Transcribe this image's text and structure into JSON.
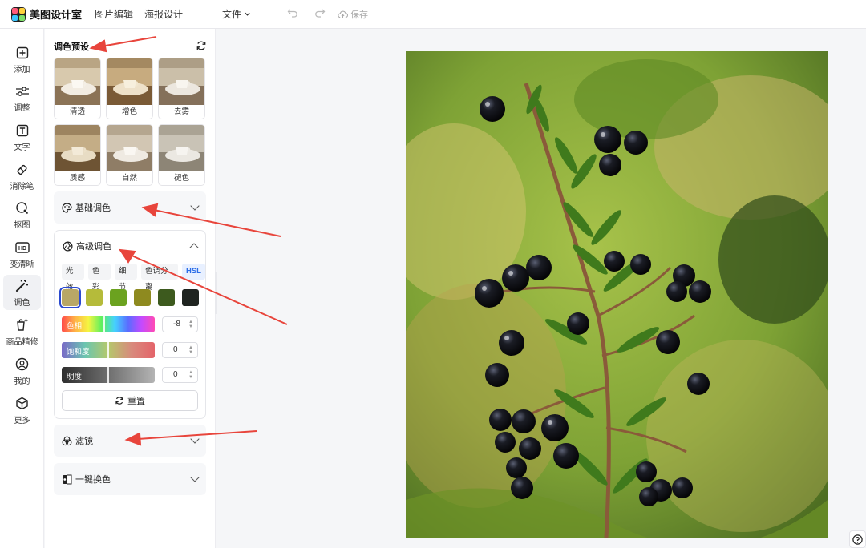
{
  "app": {
    "name": "美图设计室"
  },
  "header": {
    "nav": [
      "图片编辑",
      "海报设计"
    ],
    "file_menu": "文件",
    "save_label": "保存"
  },
  "sidebar": {
    "items": [
      {
        "label": "添加",
        "icon": "plus-square-icon"
      },
      {
        "label": "调整",
        "icon": "sliders-icon"
      },
      {
        "label": "文字",
        "icon": "text-icon"
      },
      {
        "label": "消除笔",
        "icon": "eraser-icon"
      },
      {
        "label": "抠图",
        "icon": "cutout-icon"
      },
      {
        "label": "变清晰",
        "icon": "hd-icon"
      },
      {
        "label": "调色",
        "icon": "magic-wand-icon",
        "active": true
      },
      {
        "label": "商品精修",
        "icon": "product-retouch-icon"
      },
      {
        "label": "我的",
        "icon": "user-icon"
      },
      {
        "label": "更多",
        "icon": "cube-icon"
      }
    ]
  },
  "panel": {
    "presets_title": "调色预设",
    "presets": [
      "清透",
      "增色",
      "去雾",
      "质感",
      "自然",
      "褪色"
    ],
    "basic_color": "基础调色",
    "advanced": {
      "title": "高级调色",
      "tabs": [
        "光效",
        "色彩",
        "细节",
        "色调分离",
        "HSL"
      ],
      "active_tab": "HSL",
      "swatches": [
        "#b8a766",
        "#b5bb3a",
        "#6ba21f",
        "#8e8a1f",
        "#3d5a1e",
        "#1f2420"
      ],
      "sliders": [
        {
          "label": "色相",
          "value": "-8"
        },
        {
          "label": "饱和度",
          "value": "0"
        },
        {
          "label": "明度",
          "value": "0"
        }
      ],
      "reset_label": "重置"
    },
    "filter": "滤镜",
    "one_click": "一键换色"
  },
  "colors": {
    "accent": "#2b6de8",
    "arrow": "#e8453c"
  }
}
